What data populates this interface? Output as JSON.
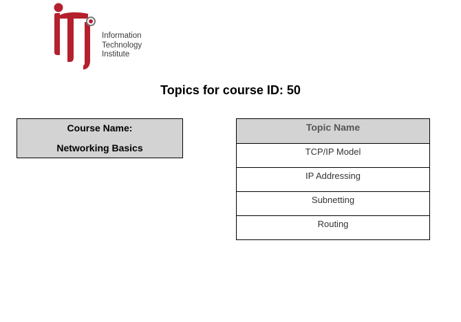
{
  "logo": {
    "line1": "Information",
    "line2": "Technology",
    "line3": "Institute",
    "brand_color": "#b5202e"
  },
  "page_title": "Topics for course ID: 50",
  "course": {
    "label": "Course Name:",
    "name": "Networking Basics"
  },
  "topics_table": {
    "header": "Topic Name",
    "rows": [
      "TCP/IP Model",
      "IP Addressing",
      "Subnetting",
      "Routing"
    ]
  }
}
